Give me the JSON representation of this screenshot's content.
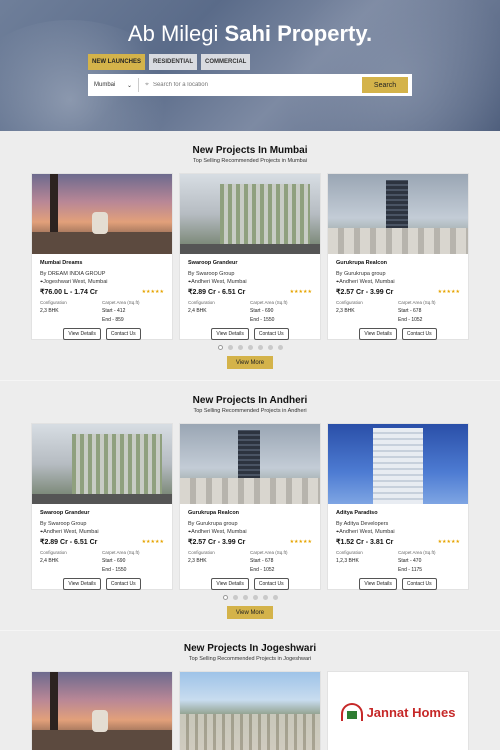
{
  "hero": {
    "title_prefix": "Ab Milegi",
    "title_bold": "Sahi Property.",
    "tabs": [
      "NEW LAUNCHES",
      "RESIDENTIAL",
      "COMMERCIAL"
    ],
    "city": "Mumbai",
    "search_placeholder": "Search for a location",
    "search_button": "Search"
  },
  "sections": [
    {
      "title": "New Projects In Mumbai",
      "subtitle": "Top Selling Recommended Projects in Mumbai",
      "cards": [
        {
          "name": "Mumbai Dreams",
          "developer": "By DREAM INDIA GROUP",
          "location": "Jogeshwari West, Mumbai",
          "price": "₹76.00 L - 1.74 Cr",
          "config": "2,3 BHK",
          "start": "Start - 412",
          "end": "End    - 859"
        },
        {
          "name": "Swaroop Grandeur",
          "developer": "By Swaroop Group",
          "location": "Andheri West, Mumbai",
          "price": "₹2.89 Cr - 6.51 Cr",
          "config": "2,4 BHK",
          "start": "Start - 690",
          "end": "End    - 1550"
        },
        {
          "name": "Gurukrupa Realcon",
          "developer": "By Gurukrupa group",
          "location": "Andheri West, Mumbai",
          "price": "₹2.57 Cr - 3.99 Cr",
          "config": "2,3 BHK",
          "start": "Start - 678",
          "end": "End    - 1052"
        }
      ]
    },
    {
      "title": "New Projects In Andheri",
      "subtitle": "Top Selling Recommended Projects in Andheri",
      "cards": [
        {
          "name": "Swaroop Grandeur",
          "developer": "By Swaroop Group",
          "location": "Andheri West, Mumbai",
          "price": "₹2.89 Cr - 6.51 Cr",
          "config": "2,4 BHK",
          "start": "Start - 690",
          "end": "End    - 1550"
        },
        {
          "name": "Gurukrupa Realcon",
          "developer": "By Gurukrupa group",
          "location": "Andheri West, Mumbai",
          "price": "₹2.57 Cr - 3.99 Cr",
          "config": "2,3 BHK",
          "start": "Start - 678",
          "end": "End    - 1052"
        },
        {
          "name": "Aditya Paradiso",
          "developer": "By Aditya Developers",
          "location": "Andheri West, Mumbai",
          "price": "₹1.52 Cr - 3.81 Cr",
          "config": "1,2,3 BHK",
          "start": "Start - 470",
          "end": "End    - 1175"
        }
      ]
    },
    {
      "title": "New Projects In Jogeshwari",
      "subtitle": "Top Selling Recommended Projects in Jogeshwari",
      "logo_text": "Jannat Homes"
    }
  ],
  "labels": {
    "configuration": "Configuration",
    "carpet_area": "Carpet Area (Sq.ft)",
    "view_details": "View Details",
    "contact_us": "Contact Us",
    "view_more": "View More",
    "stars": "★★★★★"
  },
  "colors": {
    "accent": "#d4b34a",
    "star": "#e6a400"
  }
}
